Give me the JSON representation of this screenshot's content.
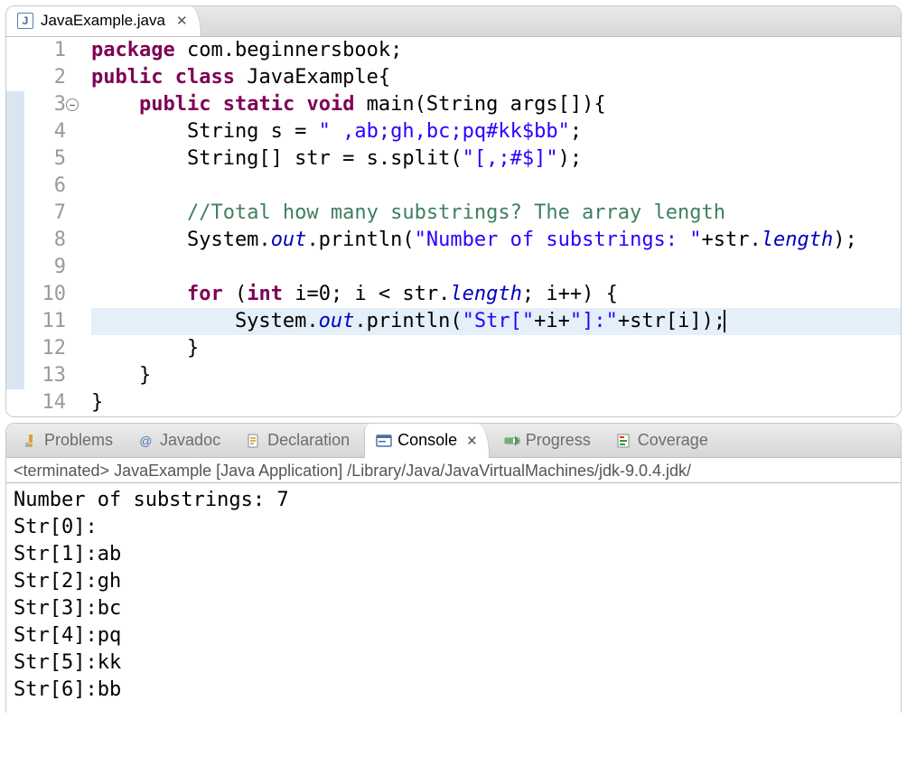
{
  "editor": {
    "tab": {
      "filename": "JavaExample.java"
    },
    "lineNumbers": [
      "1",
      "2",
      "3",
      "4",
      "5",
      "6",
      "7",
      "8",
      "9",
      "10",
      "11",
      "12",
      "13",
      "14"
    ],
    "foldAtLine": 3,
    "highlightedLine": 11,
    "foldMarkerLines": [
      3,
      4,
      5,
      6,
      7,
      8,
      9,
      10,
      11,
      12,
      13
    ],
    "code": [
      [
        {
          "c": "kw",
          "t": "package"
        },
        {
          "c": "plain",
          "t": " com.beginnersbook;"
        }
      ],
      [
        {
          "c": "kw",
          "t": "public"
        },
        {
          "c": "plain",
          "t": " "
        },
        {
          "c": "kw",
          "t": "class"
        },
        {
          "c": "plain",
          "t": " JavaExample{"
        }
      ],
      [
        {
          "c": "plain",
          "t": "    "
        },
        {
          "c": "kw",
          "t": "public"
        },
        {
          "c": "plain",
          "t": " "
        },
        {
          "c": "kw",
          "t": "static"
        },
        {
          "c": "plain",
          "t": " "
        },
        {
          "c": "kw",
          "t": "void"
        },
        {
          "c": "plain",
          "t": " main(String args[]){"
        }
      ],
      [
        {
          "c": "plain",
          "t": "        String s = "
        },
        {
          "c": "str",
          "t": "\" ,ab;gh,bc;pq#kk$bb\""
        },
        {
          "c": "plain",
          "t": ";"
        }
      ],
      [
        {
          "c": "plain",
          "t": "        String[] str = s.split("
        },
        {
          "c": "str",
          "t": "\"[,;#$]\""
        },
        {
          "c": "plain",
          "t": ");"
        }
      ],
      [
        {
          "c": "plain",
          "t": ""
        }
      ],
      [
        {
          "c": "plain",
          "t": "        "
        },
        {
          "c": "cmt",
          "t": "//Total how many substrings? The array length"
        }
      ],
      [
        {
          "c": "plain",
          "t": "        System."
        },
        {
          "c": "fld",
          "t": "out"
        },
        {
          "c": "plain",
          "t": ".println("
        },
        {
          "c": "str",
          "t": "\"Number of substrings: \""
        },
        {
          "c": "plain",
          "t": "+str."
        },
        {
          "c": "fld",
          "t": "length"
        },
        {
          "c": "plain",
          "t": ");"
        }
      ],
      [
        {
          "c": "plain",
          "t": ""
        }
      ],
      [
        {
          "c": "plain",
          "t": "        "
        },
        {
          "c": "kw",
          "t": "for"
        },
        {
          "c": "plain",
          "t": " ("
        },
        {
          "c": "kw",
          "t": "int"
        },
        {
          "c": "plain",
          "t": " i=0; i < str."
        },
        {
          "c": "fld",
          "t": "length"
        },
        {
          "c": "plain",
          "t": "; i++) {"
        }
      ],
      [
        {
          "c": "plain",
          "t": "            System."
        },
        {
          "c": "fld",
          "t": "out"
        },
        {
          "c": "plain",
          "t": ".println("
        },
        {
          "c": "str",
          "t": "\"Str[\""
        },
        {
          "c": "plain",
          "t": "+i+"
        },
        {
          "c": "str",
          "t": "\"]:\""
        },
        {
          "c": "plain",
          "t": "+str[i]);"
        }
      ],
      [
        {
          "c": "plain",
          "t": "        }"
        }
      ],
      [
        {
          "c": "plain",
          "t": "    }"
        }
      ],
      [
        {
          "c": "plain",
          "t": "}"
        }
      ]
    ]
  },
  "views": {
    "tabs": [
      {
        "id": "problems",
        "label": "Problems"
      },
      {
        "id": "javadoc",
        "label": "Javadoc"
      },
      {
        "id": "declaration",
        "label": "Declaration"
      },
      {
        "id": "console",
        "label": "Console",
        "active": true
      },
      {
        "id": "progress",
        "label": "Progress"
      },
      {
        "id": "coverage",
        "label": "Coverage"
      }
    ]
  },
  "console": {
    "status": "<terminated> JavaExample [Java Application] /Library/Java/JavaVirtualMachines/jdk-9.0.4.jdk/",
    "lines": [
      "Number of substrings: 7",
      "Str[0]:",
      "Str[1]:ab",
      "Str[2]:gh",
      "Str[3]:bc",
      "Str[4]:pq",
      "Str[5]:kk",
      "Str[6]:bb"
    ]
  }
}
